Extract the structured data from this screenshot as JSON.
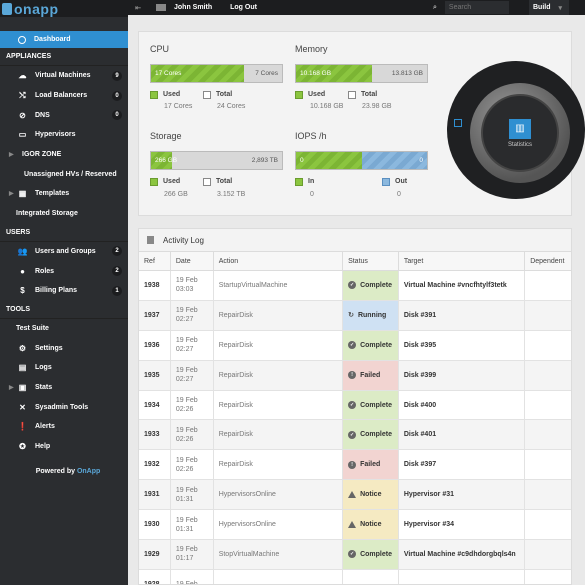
{
  "app": {
    "logo": "onapp"
  },
  "topbar": {
    "user": "John Smith",
    "logout": "Log Out",
    "search_placeholder": "Search",
    "build": "Build"
  },
  "sidebar": {
    "dashboard": "Dashboard",
    "appliances_title": "APPLIANCES",
    "items": [
      {
        "label": "Virtual Machines",
        "badge": "9"
      },
      {
        "label": "Load Balancers",
        "badge": "0"
      },
      {
        "label": "DNS",
        "badge": "0"
      },
      {
        "label": "Hypervisors"
      }
    ],
    "igor_zone": "IGOR ZONE",
    "unassigned": "Unassigned HVs / Reserved",
    "templates": "Templates",
    "integrated_storage": "Integrated Storage",
    "users_title": "USERS",
    "users_items": [
      {
        "label": "Users and Groups",
        "badge": "2"
      },
      {
        "label": "Roles",
        "badge": "2"
      },
      {
        "label": "Billing Plans",
        "badge": "1"
      }
    ],
    "tools_title": "TOOLS",
    "test_suite": "Test Suite",
    "tools_items": [
      {
        "label": "Settings"
      },
      {
        "label": "Logs"
      },
      {
        "label": "Stats"
      },
      {
        "label": "Sysadmin Tools"
      },
      {
        "label": "Alerts"
      },
      {
        "label": "Help"
      }
    ],
    "powered_prefix": "Powered by",
    "powered_brand": "OnApp"
  },
  "stats": {
    "cpu": {
      "title": "CPU",
      "used_bar": "17 Cores",
      "total_bar": "7 Cores",
      "used_label": "Used",
      "used_value": "17 Cores",
      "total_label": "Total",
      "total_value": "24 Cores",
      "fraction": 0.71
    },
    "memory": {
      "title": "Memory",
      "used_bar": "10.168 GB",
      "total_bar": "13.813 GB",
      "used_label": "Used",
      "used_value": "10.168 GB",
      "total_label": "Total",
      "total_value": "23.98 GB",
      "fraction": 0.58
    },
    "storage": {
      "title": "Storage",
      "used_bar": "266 GB",
      "total_bar": "2,893 TB",
      "used_label": "Used",
      "used_value": "266 GB",
      "total_label": "Total",
      "total_value": "3.152 TB",
      "fraction": 0.16
    },
    "iops": {
      "title": "IOPS /h",
      "in_bar": "0",
      "out_bar": "0",
      "in_label": "In",
      "in_value": "0",
      "out_label": "Out",
      "out_value": "0"
    },
    "dial_label": "Statistics"
  },
  "log": {
    "title": "Activity Log",
    "columns": [
      "Ref",
      "Date",
      "Action",
      "Status",
      "Target",
      "Dependent"
    ],
    "rows": [
      {
        "ref": "1938",
        "date1": "19 Feb",
        "date2": "03:03",
        "action": "StartupVirtualMachine",
        "status": "Complete",
        "target": "Virtual Machine #vncfhtylf3tetk"
      },
      {
        "ref": "1937",
        "date1": "19 Feb",
        "date2": "02:27",
        "action": "RepairDisk",
        "status": "Running",
        "target": "Disk #391"
      },
      {
        "ref": "1936",
        "date1": "19 Feb",
        "date2": "02:27",
        "action": "RepairDisk",
        "status": "Complete",
        "target": "Disk #395"
      },
      {
        "ref": "1935",
        "date1": "19 Feb",
        "date2": "02:27",
        "action": "RepairDisk",
        "status": "Failed",
        "target": "Disk #399"
      },
      {
        "ref": "1934",
        "date1": "19 Feb",
        "date2": "02:26",
        "action": "RepairDisk",
        "status": "Complete",
        "target": "Disk #400"
      },
      {
        "ref": "1933",
        "date1": "19 Feb",
        "date2": "02:26",
        "action": "RepairDisk",
        "status": "Complete",
        "target": "Disk #401"
      },
      {
        "ref": "1932",
        "date1": "19 Feb",
        "date2": "02:26",
        "action": "RepairDisk",
        "status": "Failed",
        "target": "Disk #397"
      },
      {
        "ref": "1931",
        "date1": "19 Feb",
        "date2": "01:31",
        "action": "HypervisorsOnline",
        "status": "Notice",
        "target": "Hypervisor #31"
      },
      {
        "ref": "1930",
        "date1": "19 Feb",
        "date2": "01:31",
        "action": "HypervisorsOnline",
        "status": "Notice",
        "target": "Hypervisor #34"
      },
      {
        "ref": "1929",
        "date1": "19 Feb",
        "date2": "01:17",
        "action": "StopVirtualMachine",
        "status": "Complete",
        "target": "Virtual Machine #c9dhdorgbqls4n"
      },
      {
        "ref": "1928",
        "date1": "19 Feb",
        "date2": "",
        "action": "",
        "status": "",
        "target": ""
      }
    ]
  }
}
